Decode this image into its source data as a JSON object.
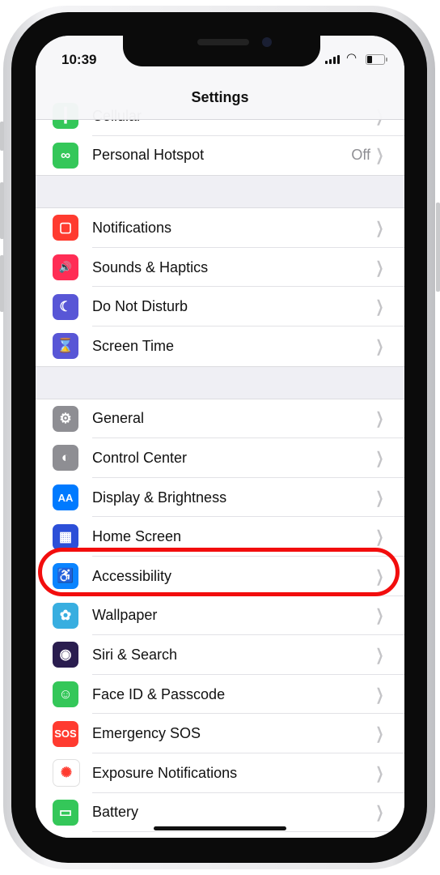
{
  "status_bar": {
    "time": "10:39",
    "wifi_icon": "wifi-icon",
    "signal_icon": "cellular-signal-icon",
    "battery_icon": "battery-icon"
  },
  "header": {
    "title": "Settings"
  },
  "highlight_color": "#f20d0d",
  "groups": [
    {
      "items": [
        {
          "label": "Cellular",
          "icon": "antenna-icon",
          "color": "#34c759",
          "glyph": "┃"
        },
        {
          "label": "Personal Hotspot",
          "icon": "hotspot-link-icon",
          "color": "#34c759",
          "glyph": "∞",
          "value": "Off"
        }
      ]
    },
    {
      "items": [
        {
          "label": "Notifications",
          "icon": "notifications-icon",
          "color": "#ff3b30",
          "glyph": "▢"
        },
        {
          "label": "Sounds & Haptics",
          "icon": "speaker-icon",
          "color": "#ff2d55",
          "glyph": "🔊"
        },
        {
          "label": "Do Not Disturb",
          "icon": "moon-icon",
          "color": "#5856d6",
          "glyph": "☾"
        },
        {
          "label": "Screen Time",
          "icon": "hourglass-icon",
          "color": "#5856d6",
          "glyph": "⌛"
        }
      ]
    },
    {
      "items": [
        {
          "label": "General",
          "icon": "gear-icon",
          "color": "#8e8e93",
          "glyph": "⚙"
        },
        {
          "label": "Control Center",
          "icon": "toggles-icon",
          "color": "#8e8e93",
          "glyph": "◐"
        },
        {
          "label": "Display & Brightness",
          "icon": "text-size-icon",
          "color": "#007aff",
          "glyph": "AA"
        },
        {
          "label": "Home Screen",
          "icon": "home-screen-grid-icon",
          "color": "#2c4fd8",
          "glyph": "▦"
        },
        {
          "label": "Accessibility",
          "icon": "accessibility-icon",
          "color": "#0a84ff",
          "glyph": "♿",
          "highlighted": true
        },
        {
          "label": "Wallpaper",
          "icon": "flower-icon",
          "color": "#38aee0",
          "glyph": "✿"
        },
        {
          "label": "Siri & Search",
          "icon": "siri-icon",
          "color": "#2a1d4f",
          "glyph": "◉"
        },
        {
          "label": "Face ID & Passcode",
          "icon": "face-id-icon",
          "color": "#34c759",
          "glyph": "☺"
        },
        {
          "label": "Emergency SOS",
          "icon": "sos-icon",
          "color": "#ff3b30",
          "glyph": "SOS"
        },
        {
          "label": "Exposure Notifications",
          "icon": "exposure-icon",
          "color": "#ffffff",
          "glyph": "✺",
          "glyph_color": "#ff3b30"
        },
        {
          "label": "Battery",
          "icon": "battery-icon",
          "color": "#34c759",
          "glyph": "▭"
        },
        {
          "label": "",
          "icon": "privacy-hand-icon",
          "color": "#007aff",
          "glyph": ""
        }
      ]
    }
  ]
}
